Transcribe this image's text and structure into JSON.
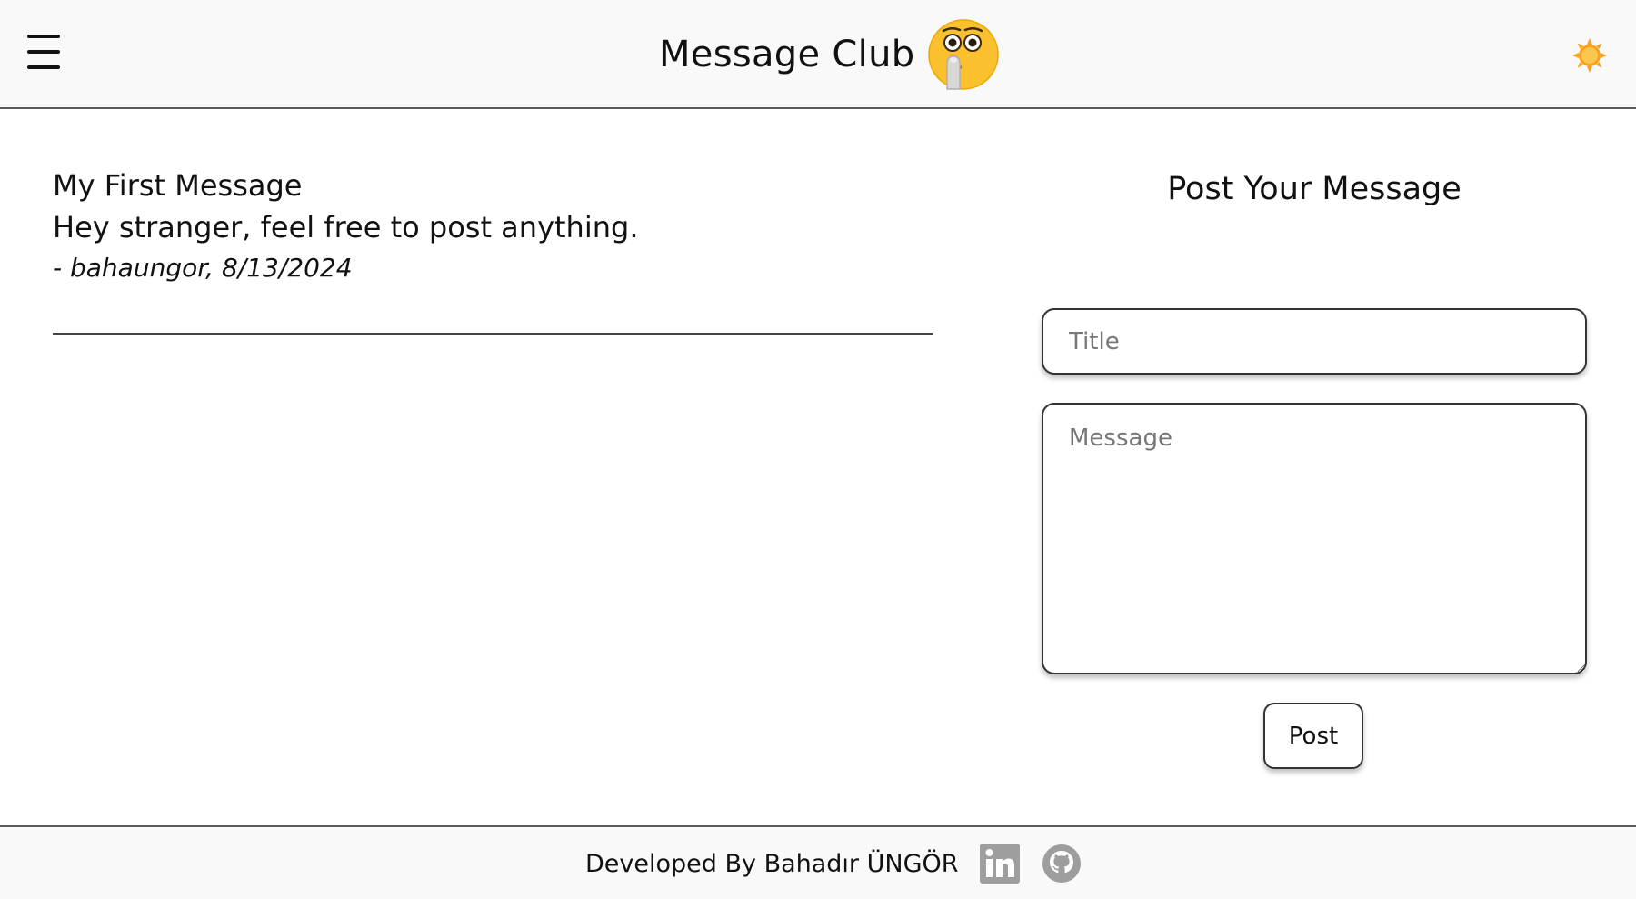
{
  "header": {
    "title": "Message Club",
    "menu_icon": "hamburger-menu-icon",
    "logo_icon": "shushing-face-emoji-icon",
    "theme_icon": "sun-icon"
  },
  "messages": [
    {
      "title": "My First Message",
      "body": "Hey stranger, feel free to post anything.",
      "meta": "- bahaungor, 8/13/2024"
    }
  ],
  "form": {
    "heading": "Post Your Message",
    "title_placeholder": "Title",
    "title_value": "",
    "message_placeholder": "Message",
    "message_value": "",
    "submit_label": "Post"
  },
  "footer": {
    "text": "Developed By Bahadır ÜNGÖR",
    "linkedin_icon": "linkedin-icon",
    "github_icon": "github-icon"
  },
  "colors": {
    "header_bg": "#f9f9f9",
    "border": "#5b5b5b",
    "emoji_yellow": "#fbc02d",
    "sun_orange": "#f6a21e",
    "icon_gray": "#9e9e9e"
  }
}
